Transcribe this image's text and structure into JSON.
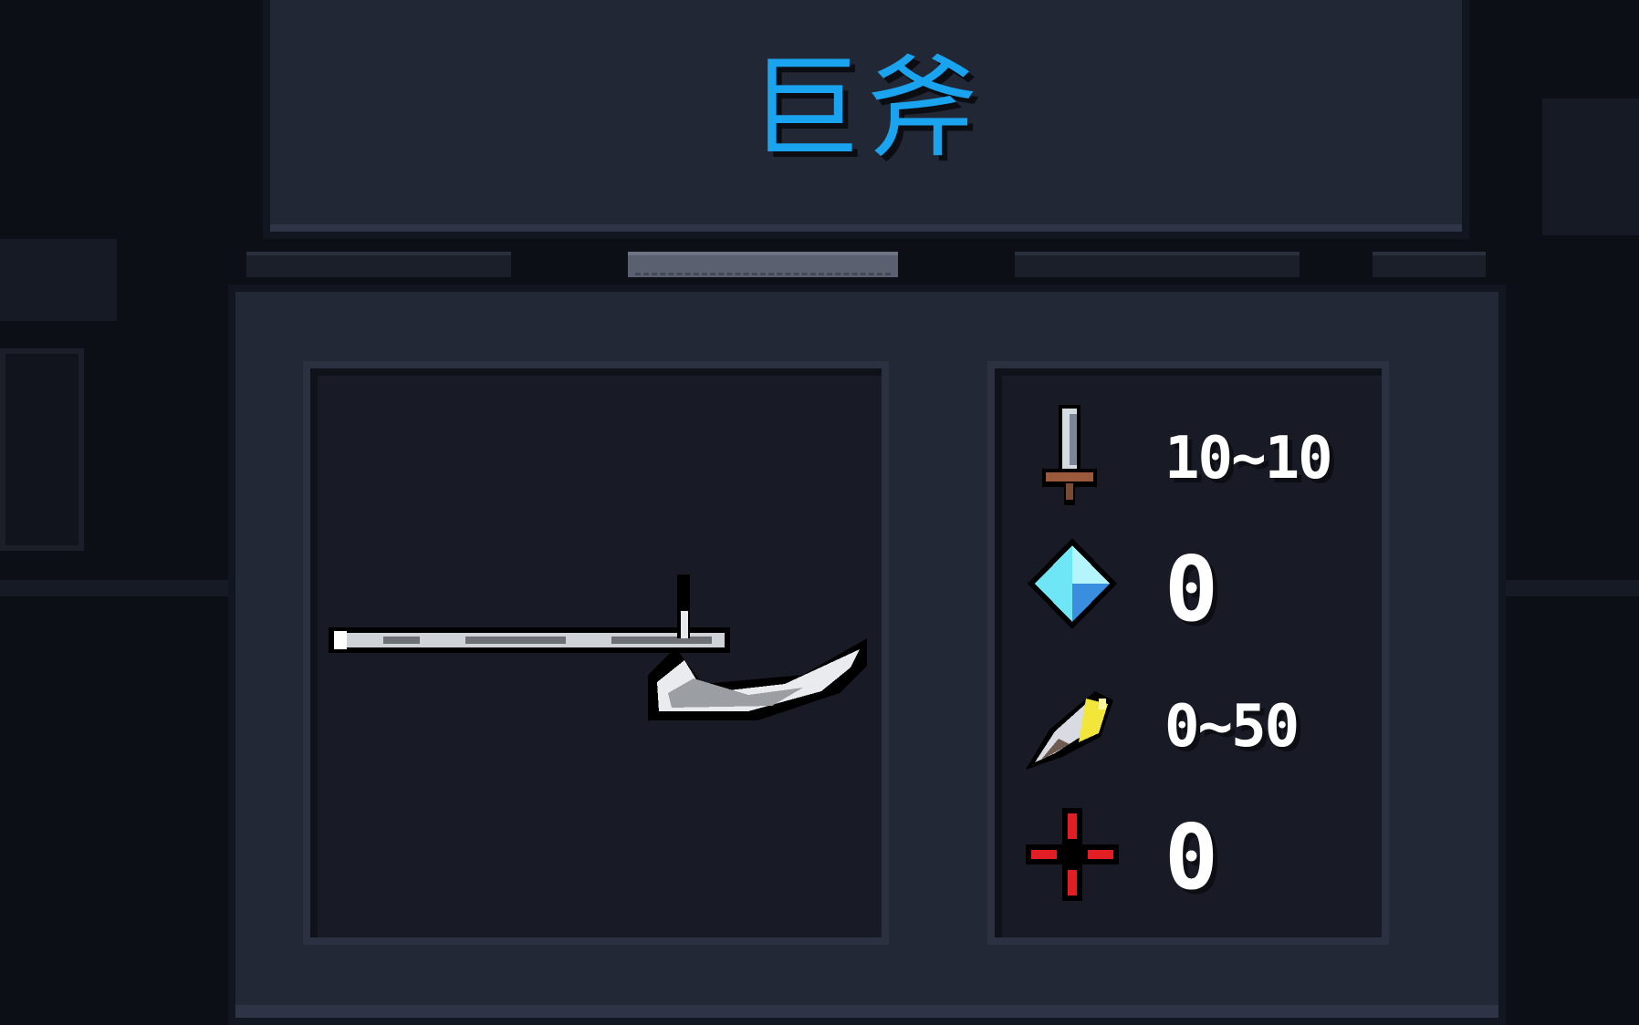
{
  "weapon": {
    "name": "巨斧",
    "icon": "great-axe-icon"
  },
  "tabs": [
    {
      "state": "inactive"
    },
    {
      "state": "active"
    },
    {
      "state": "inactive"
    },
    {
      "state": "inactive"
    }
  ],
  "stats": [
    {
      "icon": "sword-damage-icon",
      "value": "10~10"
    },
    {
      "icon": "energy-crystal-icon",
      "value": "0"
    },
    {
      "icon": "critical-feather-icon",
      "value": "0~50"
    },
    {
      "icon": "accuracy-cross-icon",
      "value": "0"
    }
  ],
  "colors": {
    "title": "#1aa3ee",
    "panel": "#232836",
    "inner": "#181b25",
    "background": "#0d0f16"
  }
}
